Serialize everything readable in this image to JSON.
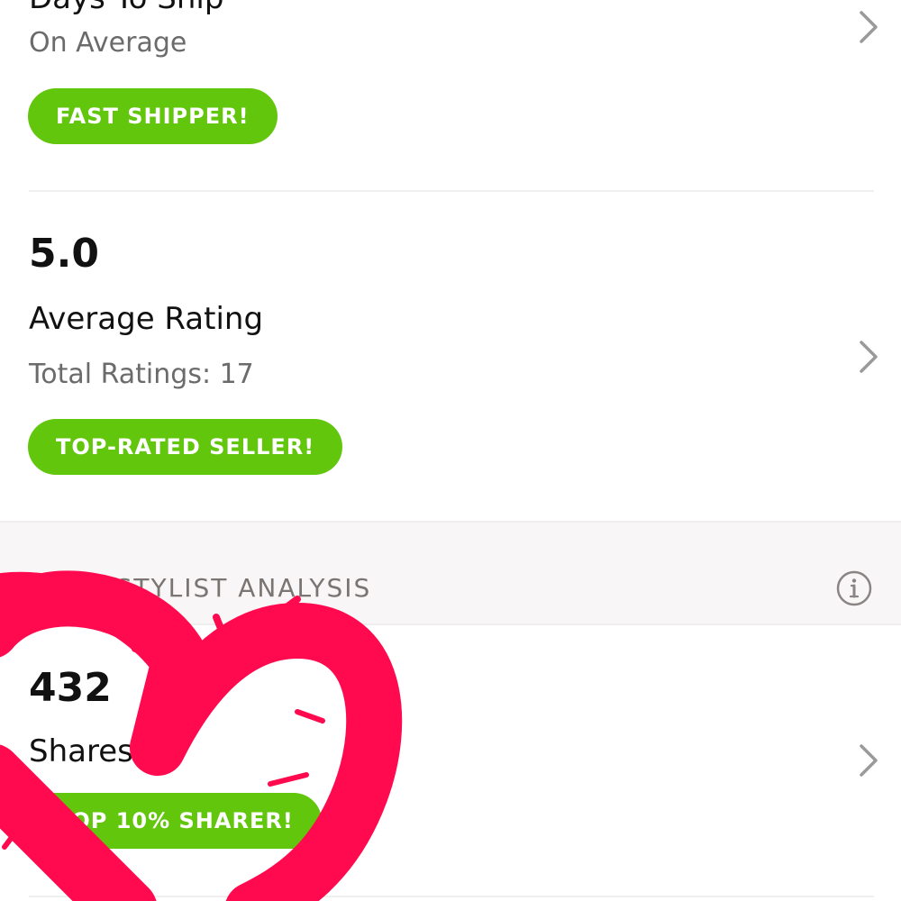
{
  "ship_metric": {
    "title": "Days To Ship",
    "subtitle": "On Average",
    "badge": "FAST SHIPPER!"
  },
  "rating_metric": {
    "value": "5.0",
    "title": "Average Rating",
    "subtitle": "Total Ratings: 17",
    "badge": "TOP-RATED SELLER!"
  },
  "stylist_section": {
    "header": "POSH STYLIST ANALYSIS",
    "info_icon": "info-circle-icon"
  },
  "shares_metric": {
    "value": "432",
    "title": "Shares",
    "badge": "TOP 10% SHARER!"
  },
  "colors": {
    "badge_green": "#62c60d",
    "heart_pink": "#ff0a4e",
    "chevron_gray": "#9a9a9a"
  },
  "icons": {
    "chevron": "chevron-right-icon",
    "overlay": "heart-sticker"
  }
}
